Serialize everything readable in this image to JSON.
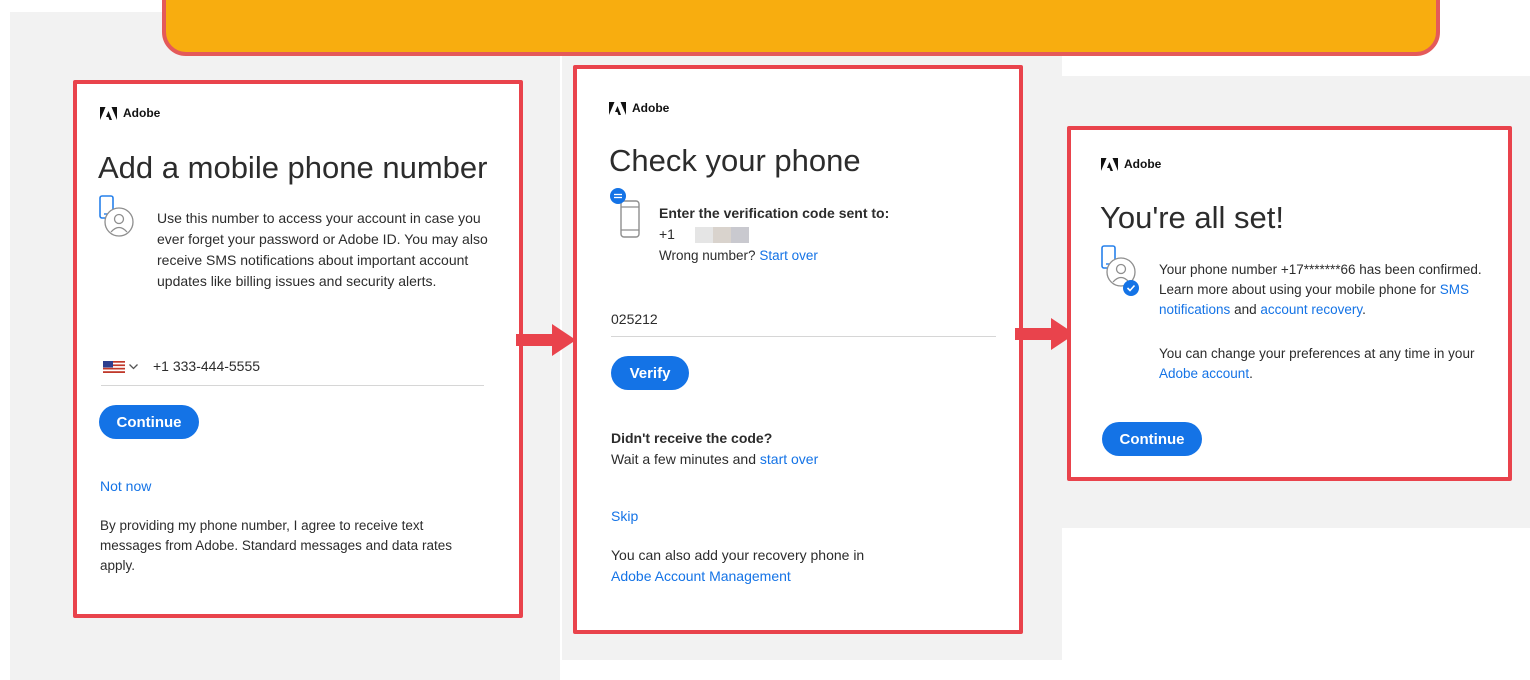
{
  "brand": "Adobe",
  "colors": {
    "accent": "#1473e6",
    "highlight_border": "#e9434c",
    "banner": "#f8ad0f"
  },
  "step1": {
    "title": "Add a mobile phone number",
    "description": "Use this number to access your account in case you ever forget your password or Adobe ID. You may also receive SMS notifications about important account updates like billing issues and security alerts.",
    "phone_value": "+1 333-444-5555",
    "country_flag": "us-flag-icon",
    "continue_label": "Continue",
    "not_now_label": "Not now",
    "consent_text": "By providing my phone number, I agree to receive text messages from Adobe. Standard messages and data rates apply."
  },
  "step2": {
    "title": "Check your phone",
    "prompt": "Enter the verification code sent to:",
    "phone_prefix": "+1",
    "wrong_number": "Wrong number?",
    "start_over": "Start over",
    "code_value": "025212",
    "verify_label": "Verify",
    "didnt_receive": "Didn't receive the code?",
    "wait_text": "Wait a few minutes and",
    "start_over_lower": "start over",
    "skip_label": "Skip",
    "recovery_text": "You can also add your recovery phone in",
    "account_mgmt_link": "Adobe Account Management"
  },
  "step3": {
    "title": "You're all set!",
    "confirm_pre": "Your phone number +17*******66 has been confirmed. Learn more about using your mobile phone for",
    "sms_link": "SMS notifications",
    "and": "and",
    "recovery_link": "account recovery",
    "period": ".",
    "prefs_text": "You can change your preferences at any time in your",
    "adobe_account_link": "Adobe account",
    "continue_label": "Continue"
  }
}
